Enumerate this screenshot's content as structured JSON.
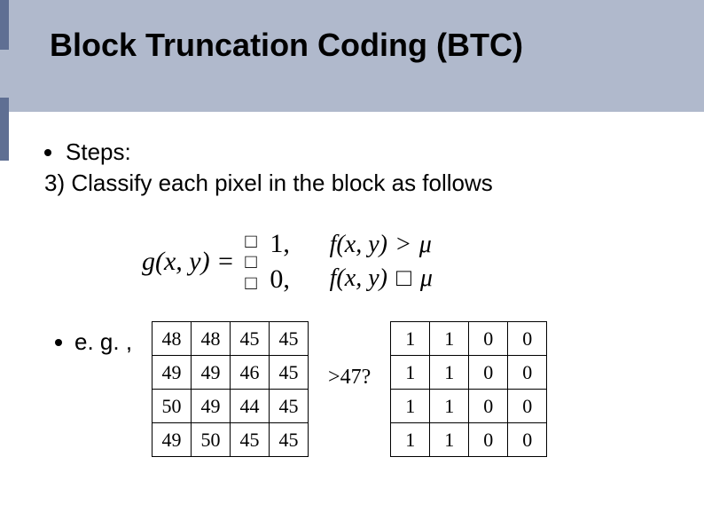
{
  "title": "Block Truncation Coding (BTC)",
  "bullet_label": "Steps:",
  "step_text": "3) Classify each pixel in the block as follows",
  "formula": {
    "lhs": "g(x, y) =",
    "box": "□",
    "val1": "1,",
    "val0": "0,",
    "cond1_lhs": "f(x, y)",
    "cond1_op": ">",
    "cond1_rhs": "μ",
    "cond0_lhs": "f(x, y)",
    "cond0_op": "□",
    "cond0_rhs": "μ"
  },
  "eg_label": "e. g. ,",
  "arrow_label": ">47?",
  "left_grid": [
    [
      "48",
      "48",
      "45",
      "45"
    ],
    [
      "49",
      "49",
      "46",
      "45"
    ],
    [
      "50",
      "49",
      "44",
      "45"
    ],
    [
      "49",
      "50",
      "45",
      "45"
    ]
  ],
  "right_grid": [
    [
      "1",
      "1",
      "0",
      "0"
    ],
    [
      "1",
      "1",
      "0",
      "0"
    ],
    [
      "1",
      "1",
      "0",
      "0"
    ],
    [
      "1",
      "1",
      "0",
      "0"
    ]
  ]
}
